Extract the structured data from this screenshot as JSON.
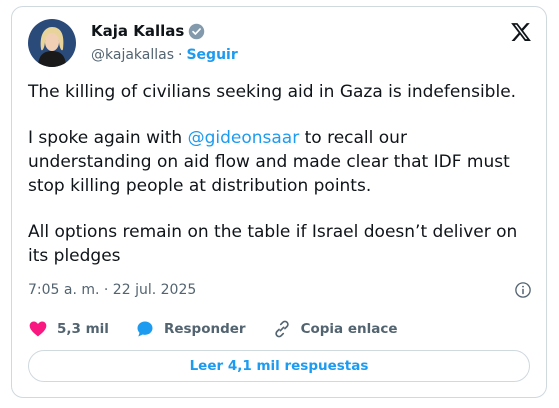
{
  "author": {
    "name": "Kaja Kallas",
    "handle": "@kajakallas",
    "separator": "·",
    "follow_label": "Seguir"
  },
  "tweet": {
    "line1": "The killing of civilians seeking aid in Gaza is indefensible.",
    "p2_before": "I spoke again with ",
    "p2_mention": "@gideonsaar",
    "p2_after": " to recall our understanding on aid flow and made clear that IDF must stop killing people at distribution points.",
    "p3": "All options remain on the table if Israel doesn’t deliver on its pledges"
  },
  "meta": {
    "timestamp": "7:05 a. m. · 22 jul. 2025"
  },
  "actions": {
    "likes": "5,3 mil",
    "reply_label": "Responder",
    "copy_label": "Copia enlace"
  },
  "replies_button": "Leer 4,1 mil respuestas",
  "colors": {
    "accent": "#1d9bf0",
    "like": "#f91880",
    "text": "#0f1419",
    "muted": "#536471"
  }
}
